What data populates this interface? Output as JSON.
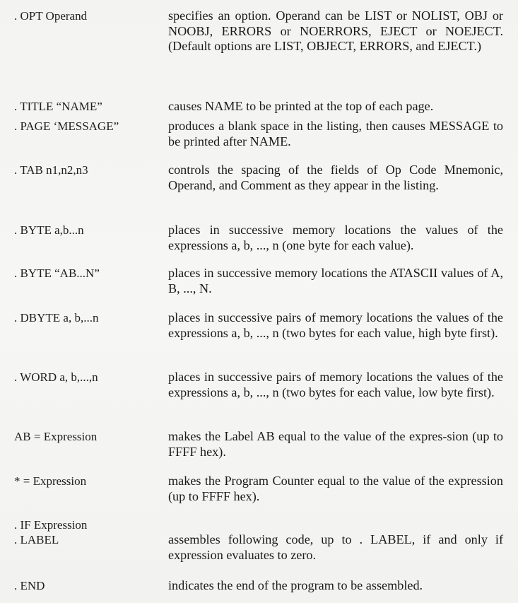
{
  "document": {
    "entries": [
      {
        "term": ". OPT Operand",
        "description": "specifies an option. Operand can be LIST or NOLIST, OBJ or NOOBJ, ERRORS or NOERRORS, EJECT or NOEJECT. (Default options are LIST, OBJECT, ERRORS, and EJECT.)"
      },
      {
        "term": ". TITLE “NAME”",
        "description": "causes NAME to be printed at the top of each page."
      },
      {
        "term": ". PAGE ‘MESSAGE”",
        "description": "produces a blank space in the listing, then causes MESSAGE to be printed after NAME."
      },
      {
        "term": ". TAB n1,n2,n3",
        "description": "controls the spacing of the fields of Op Code Mnemonic, Operand, and Comment as they appear in the listing."
      },
      {
        "term": ". BYTE a,b...n",
        "description": "places in successive memory locations the values of the expressions a, b, ..., n (one byte for each value)."
      },
      {
        "term": ". BYTE “AB...N”",
        "description": "places in successive memory locations the ATASCII values of A, B, ..., N."
      },
      {
        "term": ". DBYTE a, b,...n",
        "description": "places in successive pairs of memory locations the values of the expressions a, b, ..., n (two bytes for each value, high byte first)."
      },
      {
        "term": ". WORD a, b,...,n",
        "description": "places in successive pairs of memory locations the values of the expressions a, b, ..., n (two bytes for each value, low byte first)."
      },
      {
        "term": "AB = Expression",
        "description": "makes the Label AB equal to the value of the expres-sion (up to FFFF hex)."
      },
      {
        "term": "* = Expression",
        "description": "makes the Program Counter equal to the value of the expression (up to FFFF hex)."
      },
      {
        "term": ". IF Expression\n. LABEL",
        "description": "assembles following code, up to . LABEL, if and only if expression evaluates to zero."
      },
      {
        "term": ". END",
        "description": "indicates the end of the program to be assembled."
      }
    ]
  }
}
